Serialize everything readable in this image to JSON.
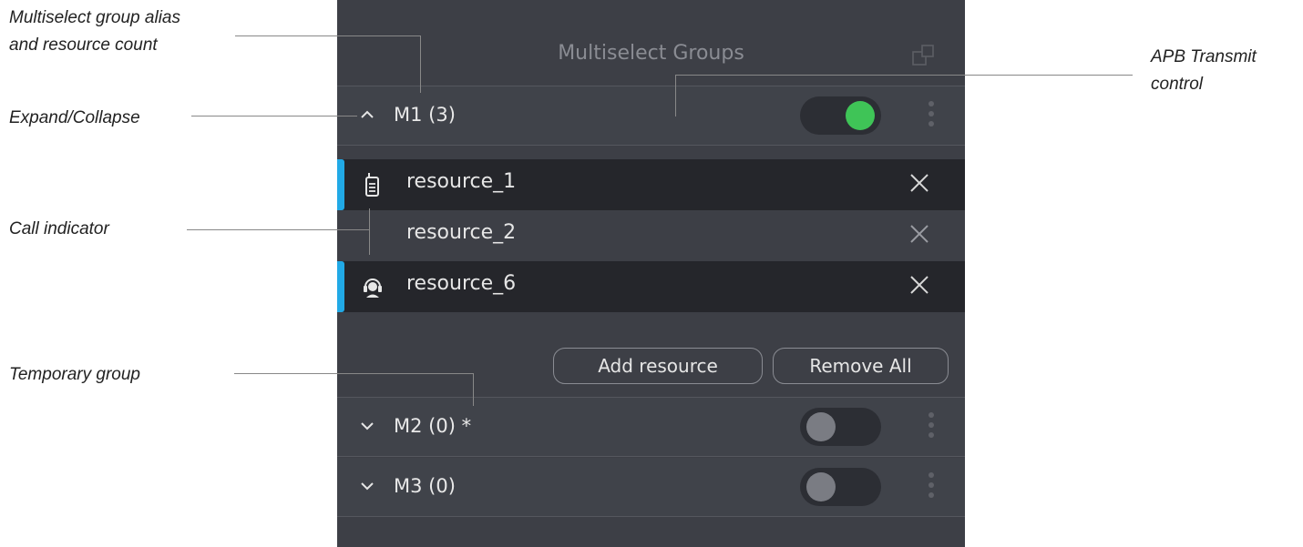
{
  "callouts": {
    "group_alias_line1": "Multiselect group alias",
    "group_alias_line2": "and resource count",
    "expand_collapse": "Expand/Collapse",
    "call_indicator": "Call indicator",
    "temporary_group": "Temporary group",
    "apb_line1": "APB Transmit",
    "apb_line2": "control"
  },
  "panel": {
    "title": "Multiselect Groups",
    "groups": [
      {
        "label": "M1 (3)",
        "expanded": true,
        "transmit_on": true,
        "resources": [
          {
            "name": "resource_1",
            "icon": "radio-icon",
            "call_active": true
          },
          {
            "name": "resource_2",
            "icon": "",
            "call_active": false
          },
          {
            "name": "resource_6",
            "icon": "operator-headset-icon",
            "call_active": true
          }
        ],
        "add_label": "Add resource",
        "remove_label": "Remove All"
      },
      {
        "label": "M2 (0) *",
        "expanded": false,
        "transmit_on": false
      },
      {
        "label": "M3 (0)",
        "expanded": false,
        "transmit_on": false
      }
    ]
  },
  "colors": {
    "panel_bg": "#3d3f46",
    "active_row_bg": "#25262b",
    "call_indicator": "#21a9e6",
    "toggle_on": "#3fc457",
    "toggle_off_knob": "#7a7c83"
  }
}
